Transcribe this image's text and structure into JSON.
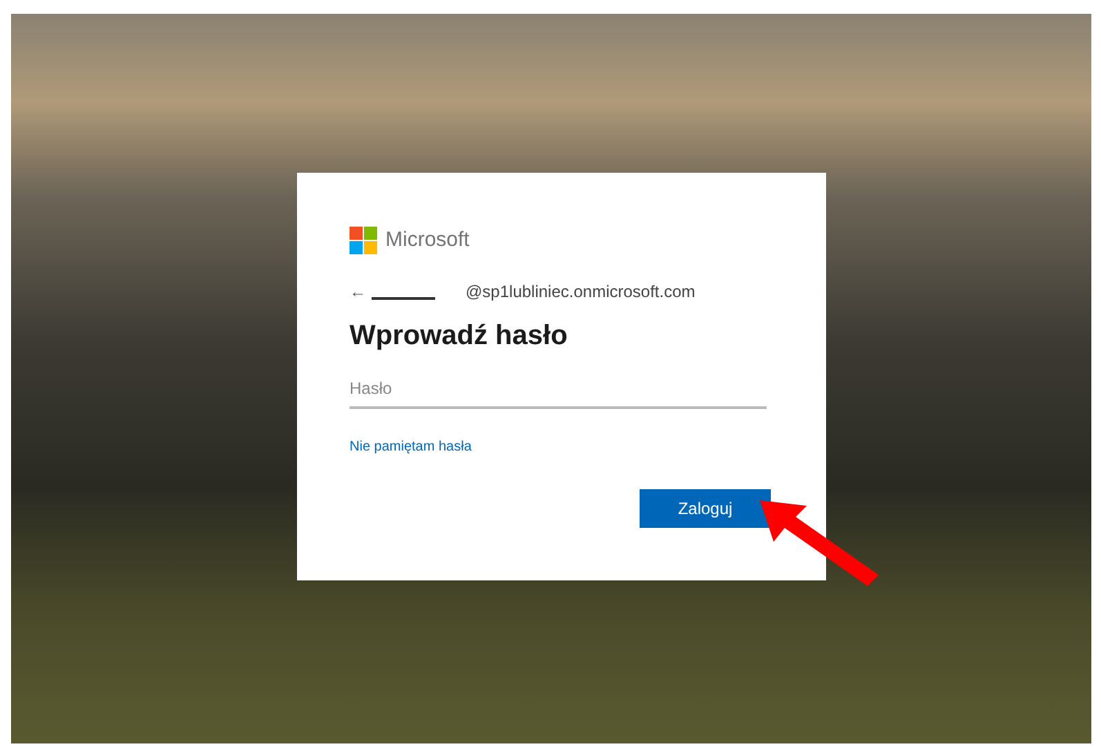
{
  "brand": {
    "name": "Microsoft"
  },
  "account": {
    "back": "←",
    "email": "@sp1lubliniec.onmicrosoft.com"
  },
  "title": "Wprowadź hasło",
  "password_field": {
    "placeholder": "Hasło"
  },
  "forgot_link": "Nie pamiętam hasła",
  "sign_in_button": "Zaloguj"
}
